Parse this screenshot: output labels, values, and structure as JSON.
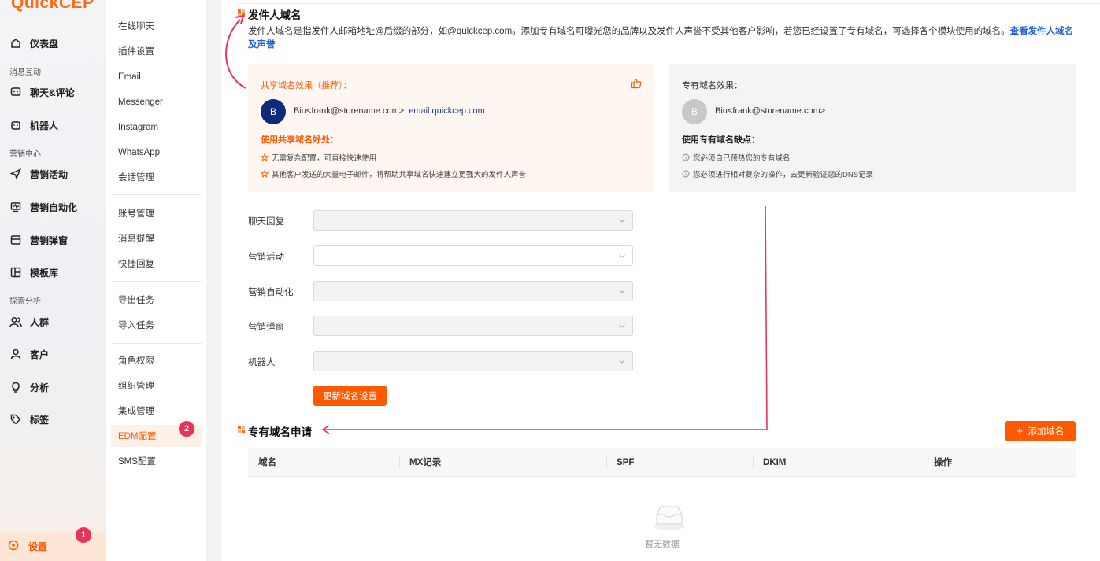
{
  "brand": {
    "logo_text": "QuickCEP",
    "accent": "#ff5a00",
    "annotation_color": "#e8335a"
  },
  "leftnav": {
    "items": [
      {
        "label": "仪表盘",
        "icon": "home-icon"
      },
      {
        "group": "消息互动"
      },
      {
        "label": "聊天&评论",
        "icon": "chat-icon"
      },
      {
        "label": "机器人",
        "icon": "robot-icon"
      },
      {
        "group": "营销中心"
      },
      {
        "label": "营销活动",
        "icon": "send-icon"
      },
      {
        "label": "营销自动化",
        "icon": "automation-icon"
      },
      {
        "label": "营销弹窗",
        "icon": "popup-icon"
      },
      {
        "label": "模板库",
        "icon": "template-icon"
      },
      {
        "group": "探索分析"
      },
      {
        "label": "人群",
        "icon": "users-icon"
      },
      {
        "label": "客户",
        "icon": "user-icon"
      },
      {
        "label": "分析",
        "icon": "bulb-icon"
      },
      {
        "label": "标签",
        "icon": "tag-icon"
      }
    ],
    "settings_label": "设置"
  },
  "subnav": {
    "items": [
      "在线聊天",
      "插件设置",
      "Email",
      "Messenger",
      "Instagram",
      "WhatsApp",
      "会话管理",
      "账号管理",
      "消息提醒",
      "快捷回复",
      "导出任务",
      "导入任务",
      "角色权限",
      "组织管理",
      "集成管理",
      "EDM配置",
      "SMS配置"
    ],
    "active": "EDM配置"
  },
  "sender_domain": {
    "title": "发件人域名",
    "description": "发件人域名是指发件人邮箱地址@后缀的部分，如@quickcep.com。添加专有域名可曝光您的品牌以及发件人声誉不受其他客户影响，若您已经设置了专有域名，可选择各个模块使用的域名。",
    "link_text": "查看发件人域名及声誉"
  },
  "shared_card": {
    "title": "共享域名效果（推荐）：",
    "avatar_letter": "B",
    "sender": "Biu<frank@storename.com>",
    "domain": "email.quickcep.com",
    "benefit_title": "使用共享域名好处：",
    "benefits": [
      "无需复杂配置，可直接快速使用",
      "其他客户发送的大量电子邮件，将帮助共享域名快速建立更强大的发件人声誉"
    ]
  },
  "private_card": {
    "title": "专有域名效果：",
    "avatar_letter": "B",
    "sender": "Biu<frank@storename.com>",
    "drawback_title": "使用专有域名缺点：",
    "drawbacks": [
      "您必须自己预热您的专有域名",
      "您必须进行相对复杂的操作，去更新验证您的DNS记录"
    ]
  },
  "form": {
    "fields": [
      {
        "label": "聊天回复",
        "value": ""
      },
      {
        "label": "营销活动",
        "value": ""
      },
      {
        "label": "营销自动化",
        "value": ""
      },
      {
        "label": "营销弹窗",
        "value": ""
      },
      {
        "label": "机器人",
        "value": ""
      }
    ],
    "submit_label": "更新域名设置"
  },
  "private_domain": {
    "title": "专有域名申请",
    "add_label": "添加域名",
    "columns": [
      "域名",
      "MX记录",
      "SPF",
      "DKIM",
      "操作"
    ],
    "empty_text": "暂无数据"
  },
  "annotations": {
    "badge_1": "1",
    "badge_2": "2"
  }
}
